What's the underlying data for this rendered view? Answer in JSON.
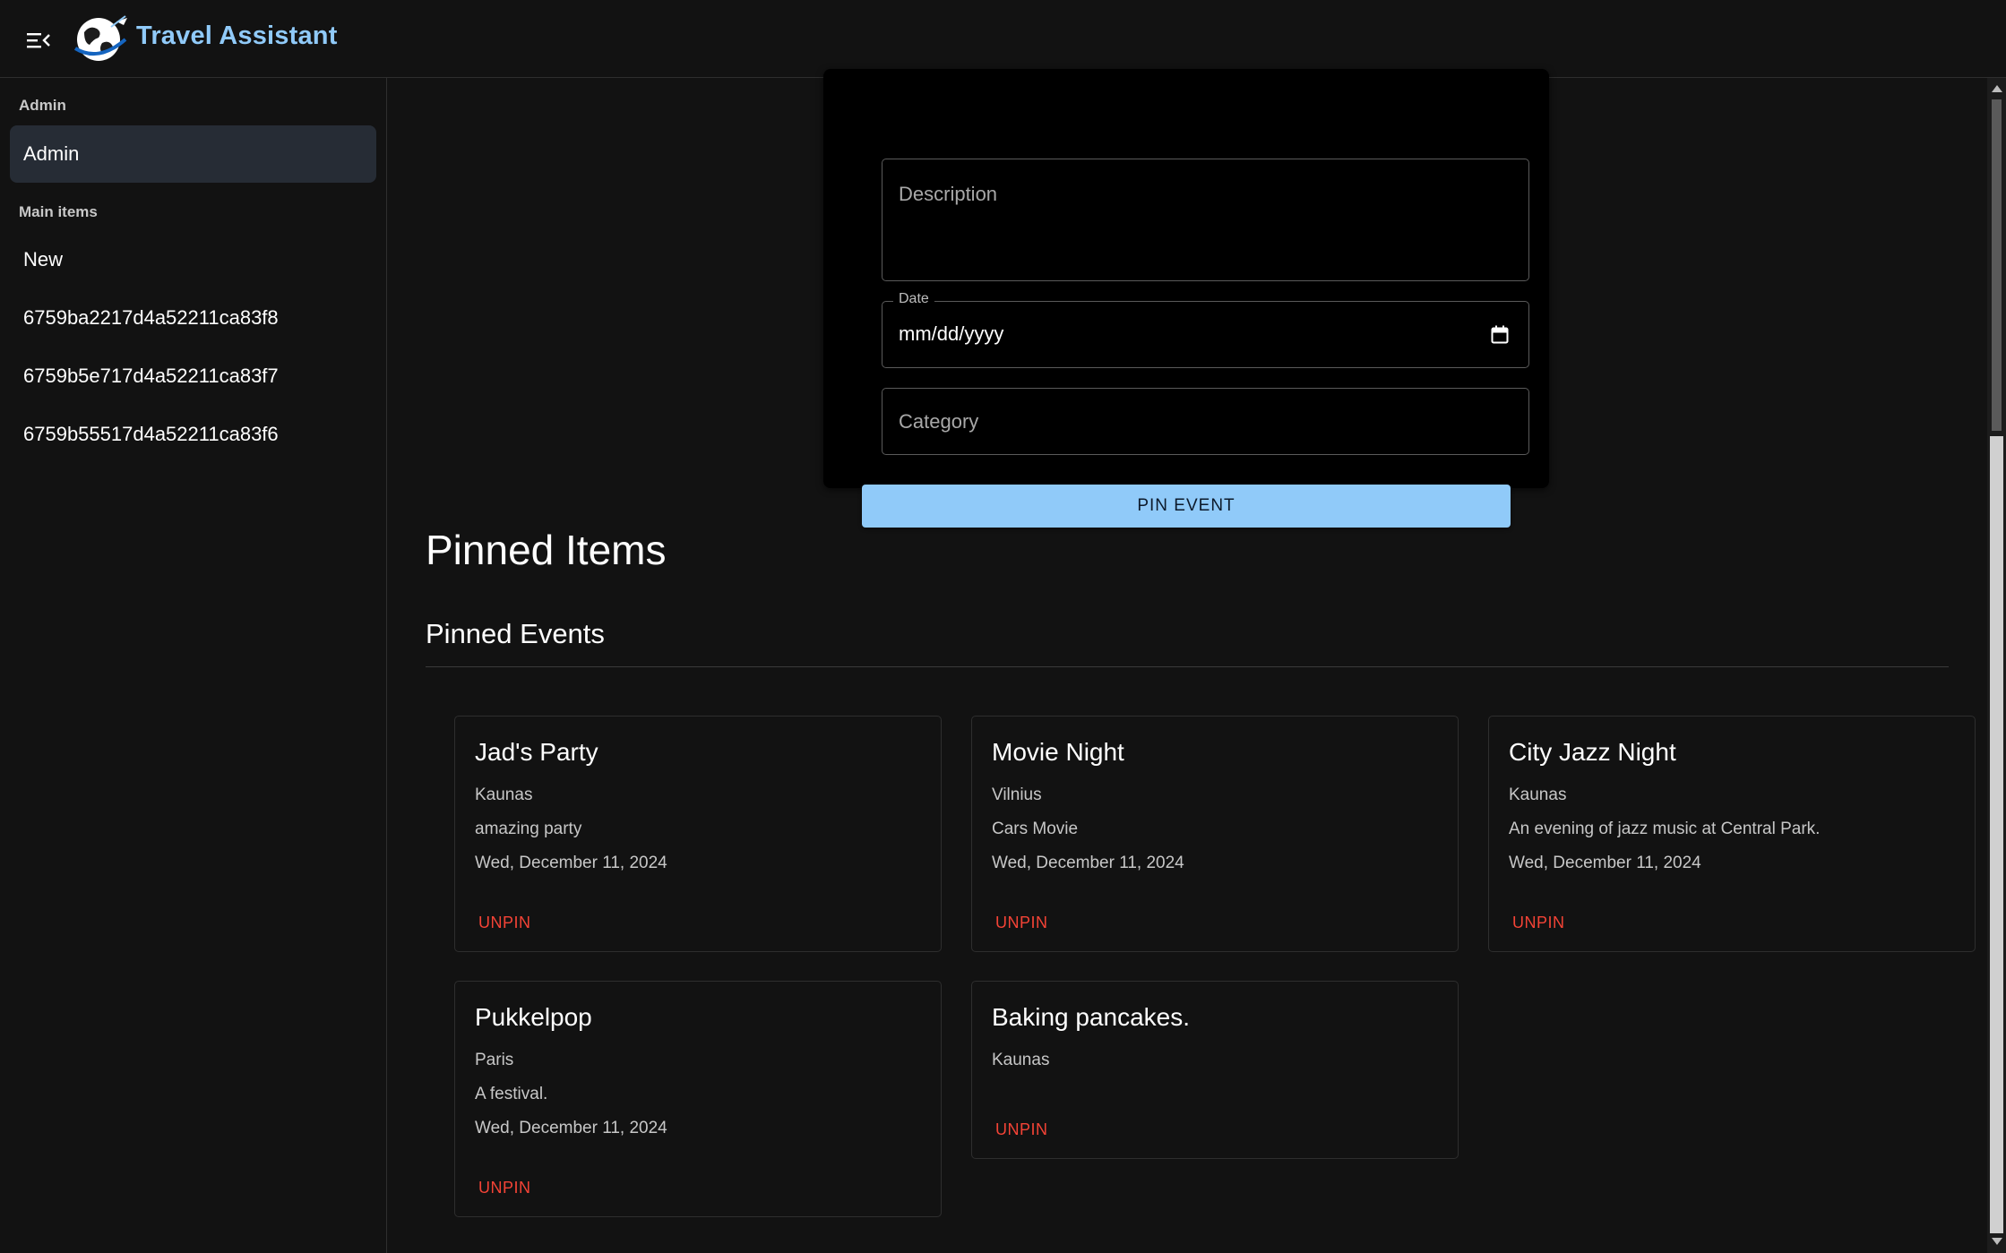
{
  "app": {
    "title": "Travel Assistant"
  },
  "sidebar": {
    "sections": [
      {
        "header": "Admin",
        "items": [
          {
            "label": "Admin",
            "selected": true
          }
        ]
      },
      {
        "header": "Main items",
        "items": [
          {
            "label": "New"
          },
          {
            "label": "6759ba2217d4a52211ca83f8"
          },
          {
            "label": "6759b5e717d4a52211ca83f7"
          },
          {
            "label": "6759b55517d4a52211ca83f6"
          }
        ]
      }
    ]
  },
  "form": {
    "description_placeholder": "Description",
    "date_label": "Date",
    "date_value": "mm/dd/yyyy",
    "category_placeholder": "Category",
    "submit_label": "PIN EVENT"
  },
  "pinned": {
    "heading": "Pinned Items",
    "events_heading": "Pinned Events",
    "unpin_label": "UNPIN",
    "events": [
      {
        "title": "Jad's Party",
        "location": "Kaunas",
        "description": "amazing party",
        "date": "Wed, December 11, 2024"
      },
      {
        "title": "Movie Night",
        "location": "Vilnius",
        "description": "Cars Movie",
        "date": "Wed, December 11, 2024"
      },
      {
        "title": "City Jazz Night",
        "location": "Kaunas",
        "description": "An evening of jazz music at Central Park.",
        "date": "Wed, December 11, 2024"
      },
      {
        "title": "Pukkelpop",
        "location": "Paris",
        "description": "A festival.",
        "date": "Wed, December 11, 2024"
      },
      {
        "title": "Baking pancakes.",
        "location": "Kaunas",
        "description": "",
        "date": ""
      }
    ]
  },
  "colors": {
    "accent": "#90caf9",
    "danger": "#f44336",
    "background": "#121212"
  }
}
